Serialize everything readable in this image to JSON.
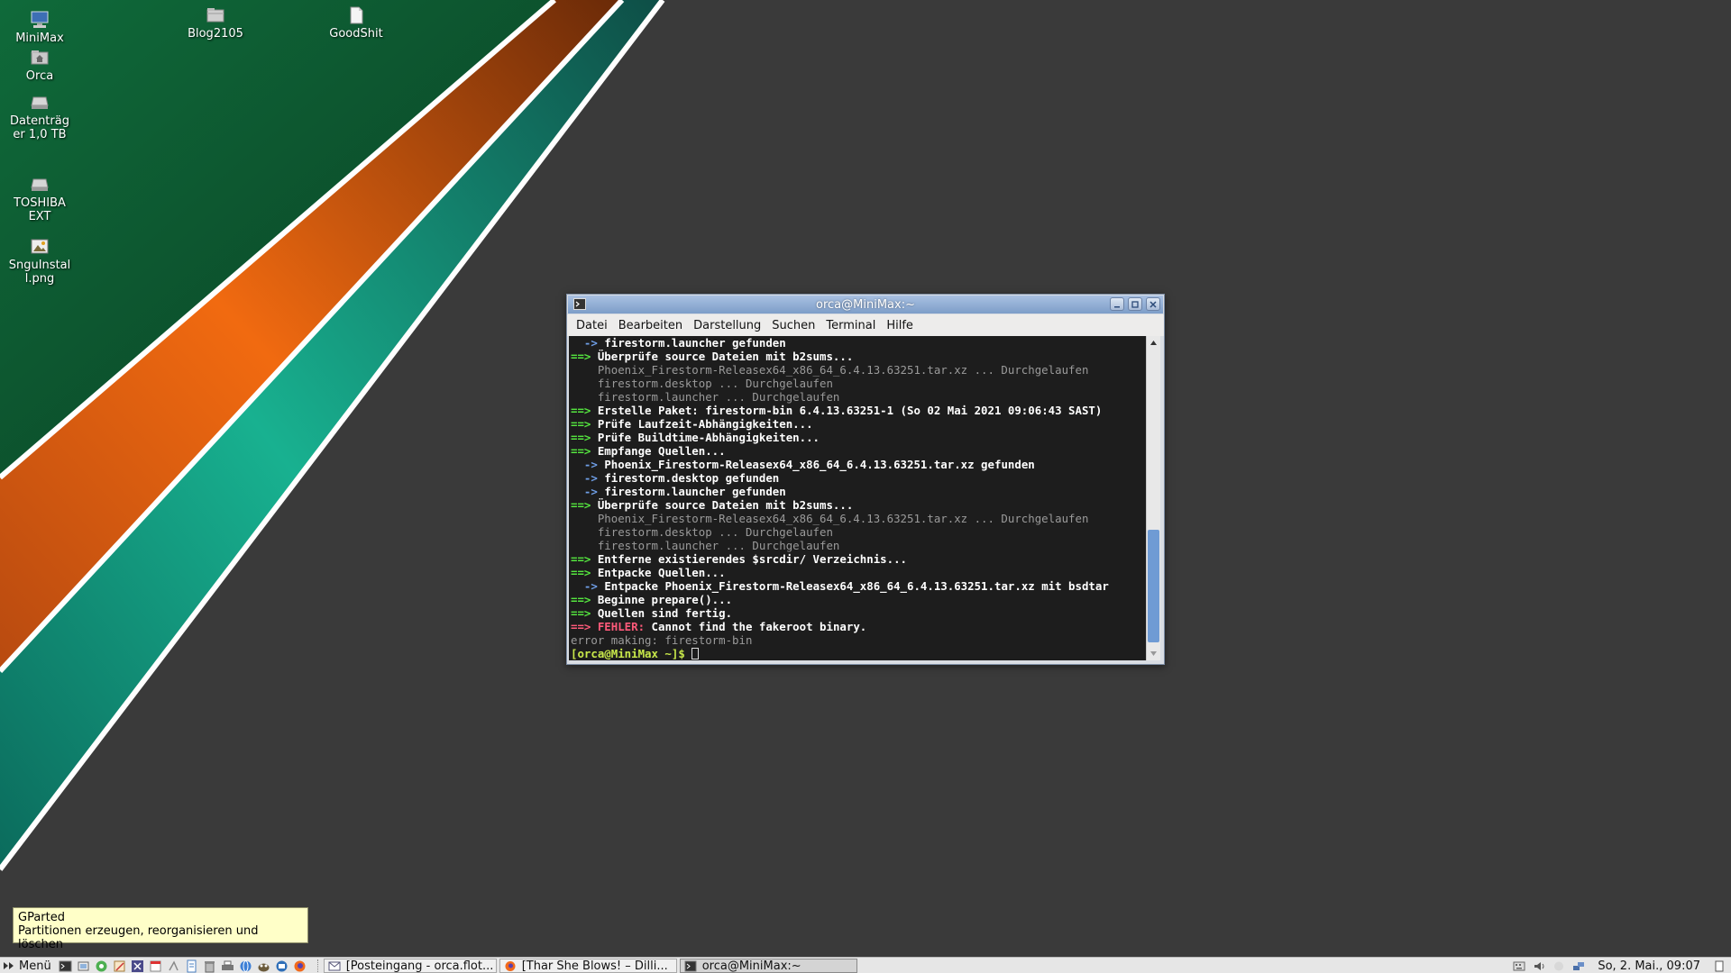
{
  "desktop": {
    "icons": [
      {
        "label": "MiniMax",
        "icon": "computer-icon"
      },
      {
        "label": "Orca",
        "icon": "home-folder-icon"
      },
      {
        "label": "Datenträger 1,0 TB",
        "icon": "drive-icon"
      },
      {
        "label": "TOSHIBA EXT",
        "icon": "drive-icon"
      },
      {
        "label": "SnguInstall.png",
        "icon": "image-file-icon"
      },
      {
        "label": "Blog2105",
        "icon": "folder-icon"
      },
      {
        "label": "GoodShit",
        "icon": "document-icon"
      }
    ]
  },
  "window": {
    "title": "orca@MiniMax:~",
    "menu": [
      "Datei",
      "Bearbeiten",
      "Darstellung",
      "Suchen",
      "Terminal",
      "Hilfe"
    ],
    "lines": [
      [
        [
          "blue",
          "  -> "
        ],
        [
          "bold",
          "firestorm.launcher gefunden"
        ]
      ],
      [
        [
          "green",
          "==> "
        ],
        [
          "bold",
          "Überprüfe source Dateien mit b2sums..."
        ]
      ],
      [
        [
          "dim",
          "    Phoenix_Firestorm-Releasex64_x86_64_6.4.13.63251.tar.xz ... Durchgelaufen"
        ]
      ],
      [
        [
          "dim",
          "    firestorm.desktop ... Durchgelaufen"
        ]
      ],
      [
        [
          "dim",
          "    firestorm.launcher ... Durchgelaufen"
        ]
      ],
      [
        [
          "green",
          "==> "
        ],
        [
          "bold",
          "Erstelle Paket: firestorm-bin 6.4.13.63251-1 (So 02 Mai 2021 09:06:43 SAST)"
        ]
      ],
      [
        [
          "green",
          "==> "
        ],
        [
          "bold",
          "Prüfe Laufzeit-Abhängigkeiten..."
        ]
      ],
      [
        [
          "green",
          "==> "
        ],
        [
          "bold",
          "Prüfe Buildtime-Abhängigkeiten..."
        ]
      ],
      [
        [
          "green",
          "==> "
        ],
        [
          "bold",
          "Empfange Quellen..."
        ]
      ],
      [
        [
          "blue",
          "  -> "
        ],
        [
          "bold",
          "Phoenix_Firestorm-Releasex64_x86_64_6.4.13.63251.tar.xz gefunden"
        ]
      ],
      [
        [
          "blue",
          "  -> "
        ],
        [
          "bold",
          "firestorm.desktop gefunden"
        ]
      ],
      [
        [
          "blue",
          "  -> "
        ],
        [
          "bold",
          "firestorm.launcher gefunden"
        ]
      ],
      [
        [
          "green",
          "==> "
        ],
        [
          "bold",
          "Überprüfe source Dateien mit b2sums..."
        ]
      ],
      [
        [
          "dim",
          "    Phoenix_Firestorm-Releasex64_x86_64_6.4.13.63251.tar.xz ... Durchgelaufen"
        ]
      ],
      [
        [
          "dim",
          "    firestorm.desktop ... Durchgelaufen"
        ]
      ],
      [
        [
          "dim",
          "    firestorm.launcher ... Durchgelaufen"
        ]
      ],
      [
        [
          "green",
          "==> "
        ],
        [
          "bold",
          "Entferne existierendes $srcdir/ Verzeichnis..."
        ]
      ],
      [
        [
          "green",
          "==> "
        ],
        [
          "bold",
          "Entpacke Quellen..."
        ]
      ],
      [
        [
          "blue",
          "  -> "
        ],
        [
          "bold",
          "Entpacke Phoenix_Firestorm-Releasex64_x86_64_6.4.13.63251.tar.xz mit bsdtar"
        ]
      ],
      [
        [
          "green",
          "==> "
        ],
        [
          "bold",
          "Beginne prepare()..."
        ]
      ],
      [
        [
          "green",
          "==> "
        ],
        [
          "bold",
          "Quellen sind fertig."
        ]
      ],
      [
        [
          "red",
          "==> FEHLER: "
        ],
        [
          "bold",
          "Cannot find the fakeroot binary."
        ]
      ],
      [
        [
          "dim",
          "error making: firestorm-bin"
        ]
      ],
      [
        [
          "prompt",
          "[orca@MiniMax ~]$ "
        ]
      ]
    ]
  },
  "tooltip": {
    "title": "GParted",
    "text": "Partitionen erzeugen, reorganisieren und löschen"
  },
  "taskbar": {
    "menu_label": "Menü",
    "launchers": [
      "terminal-icon",
      "files-icon",
      "network-icon",
      "text-editor-icon",
      "settings-icon",
      "calendar-icon",
      "notes-icon",
      "document-icon",
      "trash-icon",
      "printer-icon",
      "browser-icon",
      "gimp-icon",
      "thunderbird-icon",
      "firefox-icon"
    ],
    "tasks": [
      {
        "label": "[Posteingang - orca.flot...",
        "icon": "mail-icon",
        "active": false
      },
      {
        "label": "[Thar She Blows! – Dilli...",
        "icon": "firefox-icon",
        "active": false
      },
      {
        "label": "orca@MiniMax:~",
        "icon": "terminal-icon",
        "active": true
      }
    ],
    "tray_icons": [
      "keyboard-icon",
      "volume-icon",
      "update-icon",
      "network-icon"
    ],
    "clock": "So,  2. Mai., 09:07"
  }
}
